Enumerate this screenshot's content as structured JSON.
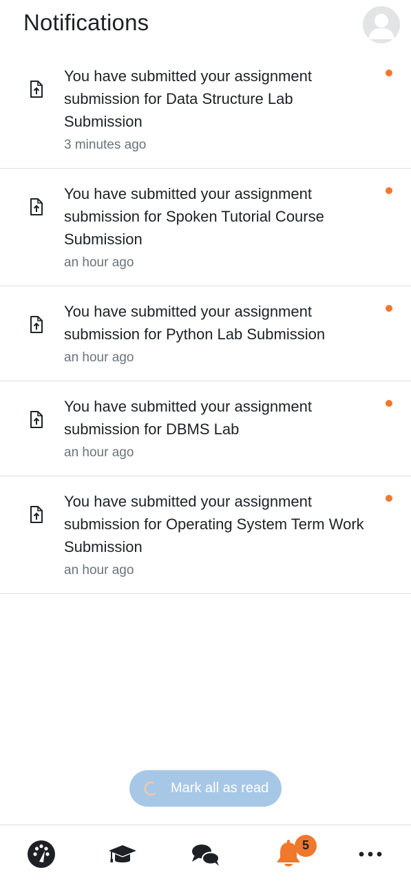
{
  "header": {
    "title": "Notifications",
    "avatar_icon": "user-avatar-icon"
  },
  "notifications": [
    {
      "text": "You have submitted your assignment submission for Data Structure Lab Submission",
      "time": "3 minutes ago",
      "icon": "file-upload-icon",
      "unread": true
    },
    {
      "text": "You have submitted your assignment submission for Spoken Tutorial Course Submission",
      "time": "an hour ago",
      "icon": "file-upload-icon",
      "unread": true
    },
    {
      "text": "You have submitted your assignment submission for Python Lab Submission",
      "time": "an hour ago",
      "icon": "file-upload-icon",
      "unread": true
    },
    {
      "text": "You have submitted your assignment submission for DBMS Lab",
      "time": "an hour ago",
      "icon": "file-upload-icon",
      "unread": true
    },
    {
      "text": "You have submitted your assignment submission for Operating System Term Work Submission",
      "time": "an hour ago",
      "icon": "file-upload-icon",
      "unread": true
    }
  ],
  "mark_all": {
    "label": "Mark all as read",
    "icon": "loading-spinner-icon"
  },
  "tabbar": {
    "items": [
      {
        "name": "dashboard",
        "icon": "dashboard-gauge-icon",
        "active": false
      },
      {
        "name": "courses",
        "icon": "graduation-cap-icon",
        "active": false
      },
      {
        "name": "messages",
        "icon": "chat-bubbles-icon",
        "active": false
      },
      {
        "name": "notifications",
        "icon": "bell-icon",
        "active": true
      },
      {
        "name": "more",
        "icon": "more-dots-icon",
        "active": false
      }
    ],
    "notification_badge": "5"
  },
  "colors": {
    "accent": "#f0782d",
    "button_bg": "#a7c7e7",
    "text": "#1d2125",
    "muted": "#6a737b",
    "divider": "#dcdee0"
  }
}
